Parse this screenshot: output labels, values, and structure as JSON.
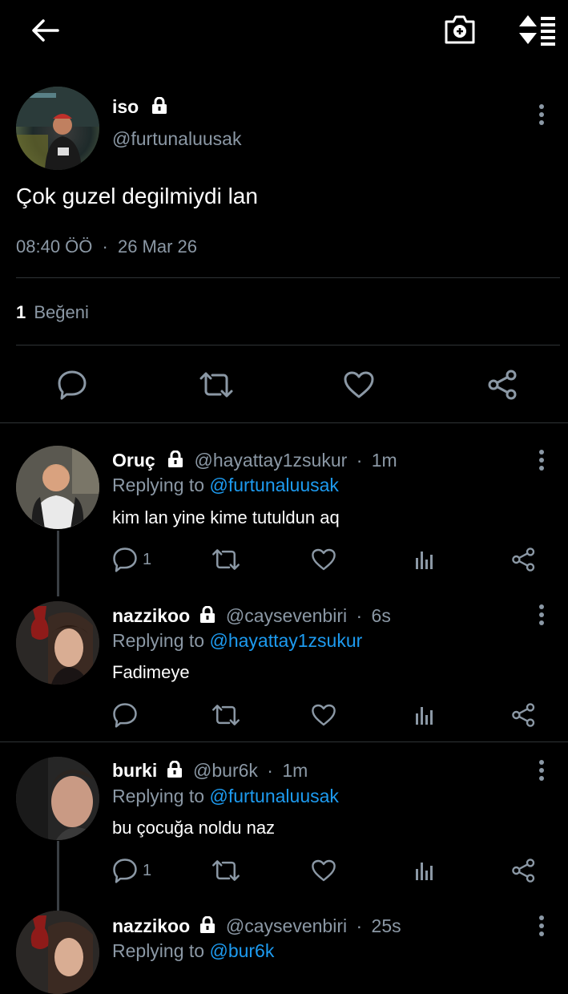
{
  "header": {
    "back_icon": "arrow-left-icon",
    "camera_icon": "camera-add-icon",
    "sort_icon": "sort-icon"
  },
  "tweet": {
    "name": "iso",
    "handle": "@furtunaluusak",
    "text": "Çok guzel degilmiydi lan",
    "time": "08:40 ÖÖ",
    "date": "26 Mar 26",
    "likes_count": "1",
    "likes_label": "Beğeni"
  },
  "replies": [
    {
      "name": "Oruç",
      "handle": "@hayattay1zsukur",
      "time": "1m",
      "replying_prefix": "Replying to",
      "replying_to": "@furtunaluusak",
      "text": "kim lan yine kime tutuldun aq",
      "reply_count": "1"
    },
    {
      "name": "nazzikoo",
      "handle": "@caysevenbiri",
      "time": "6s",
      "replying_prefix": "Replying to",
      "replying_to": "@hayattay1zsukur",
      "text": "Fadimeye",
      "reply_count": ""
    },
    {
      "name": "burki",
      "handle": "@bur6k",
      "time": "1m",
      "replying_prefix": "Replying to",
      "replying_to": "@furtunaluusak",
      "text": "bu çocuğa noldu naz",
      "reply_count": "1"
    },
    {
      "name": "nazzikoo",
      "handle": "@caysevenbiri",
      "time": "25s",
      "replying_prefix": "Replying to",
      "replying_to": "@bur6k",
      "text": "",
      "reply_count": ""
    }
  ],
  "colors": {
    "background": "#000000",
    "muted": "#8b98a5",
    "link": "#1d9bf0",
    "divider": "#2f3336"
  }
}
